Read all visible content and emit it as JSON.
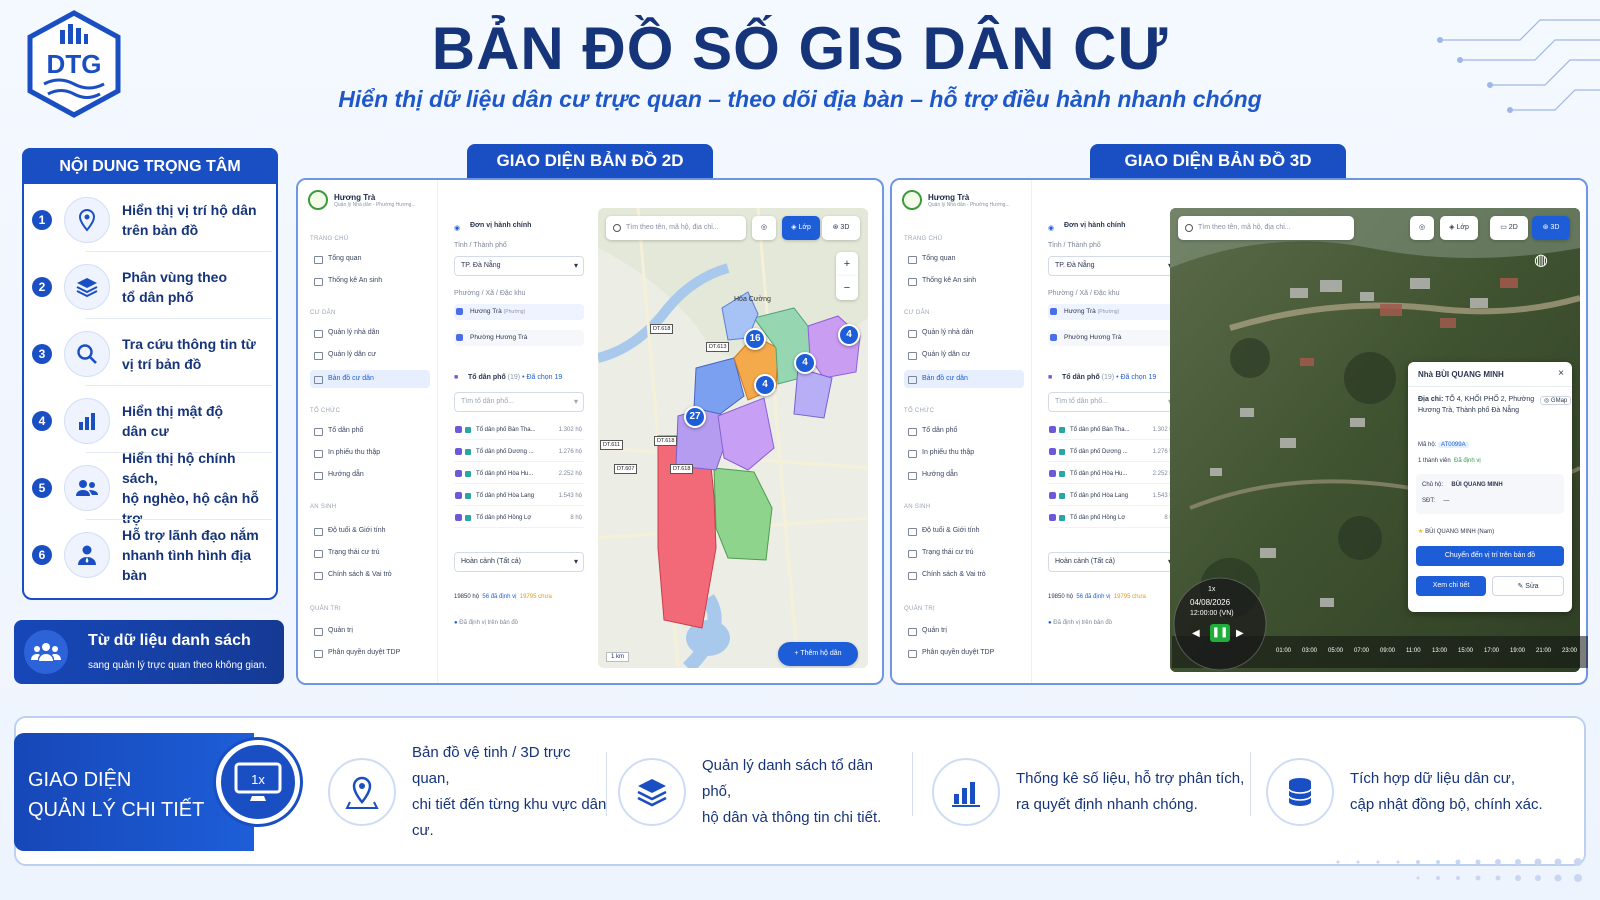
{
  "header": {
    "logo_text": "DTG",
    "title": "BẢN ĐỒ SỐ GIS DÂN CƯ",
    "subtitle": "Hiển thị dữ liệu dân cư trực quan – theo dõi địa bàn – hỗ trợ điều hành nhanh chóng"
  },
  "left_panel": {
    "title": "NỘI DUNG TRỌNG TÂM",
    "items": [
      {
        "num": "1",
        "line1": "Hiển thị vị trí hộ dân",
        "line2": "trên bản đồ",
        "icon": "map-pin-icon"
      },
      {
        "num": "2",
        "line1": "Phân vùng theo",
        "line2": "tổ dân phố",
        "icon": "layers-icon"
      },
      {
        "num": "3",
        "line1": "Tra cứu thông tin từ",
        "line2": "vị trí bản đồ",
        "icon": "search-icon"
      },
      {
        "num": "4",
        "line1": "Hiển thị mật độ",
        "line2": "dân cư",
        "icon": "bar-chart-icon"
      },
      {
        "num": "5",
        "line1": "Hiển thị hộ chính sách,",
        "line2": "hộ nghèo, hộ cận hỗ trợ",
        "icon": "users-icon"
      },
      {
        "num": "6",
        "line1": "Hỗ trợ lãnh đạo nắm",
        "line2": "nhanh tình hình địa bàn",
        "icon": "leader-icon"
      }
    ],
    "callout_title": "Từ dữ liệu danh sách",
    "callout_sub": "sang quản lý trực quan theo không gian."
  },
  "section_2d": {
    "title": "GIAO DIỆN BẢN ĐỒ 2D"
  },
  "section_3d": {
    "title": "GIAO DIỆN BẢN ĐỒ 3D"
  },
  "app": {
    "brand": "Hương Trà",
    "brand_sub": "Quản lý Nhà dân - Phường Hương...",
    "groups": {
      "g1": "TRANG CHỦ",
      "g2": "CƯ DÂN",
      "g3": "TỔ CHỨC",
      "g4": "AN SINH",
      "g5": "QUẢN TRỊ"
    },
    "menu": {
      "tong_quan": "Tổng quan",
      "thong_ke": "Thống kê An sinh",
      "ql_nha_dan": "Quản lý nhà dân",
      "ql_dan_cu": "Quản lý dân cư",
      "ban_do": "Bản đồ cư dân",
      "to_dan_pho": "Tổ dân phố",
      "in_phieu": "In phiếu thu thập",
      "huong_dan": "Hướng dẫn",
      "do_tuoi": "Độ tuổi & Giới tính",
      "trang_thai": "Trạng thái cư trú",
      "chinh_sach": "Chính sách & Vai trò",
      "quan_tri": "Quản trị",
      "phan_quyen": "Phân quyền duyệt TDP"
    },
    "filter": {
      "title": "Đơn vị hành chính",
      "tinh_label": "Tỉnh / Thành phố",
      "tinh_value": "TP. Đà Nẵng",
      "phuong_label": "Phường / Xã / Đặc khu",
      "phuong_1": "Hương Trà",
      "phuong_1_tag": "(Phường)",
      "phuong_2": "Phường Hương Trà",
      "tdp_title": "Tổ dân phố",
      "tdp_count": "(19)",
      "tdp_selected": "• Đã chọn 19",
      "tdp_search": "Tìm tổ dân phố...",
      "tdp_rows": [
        {
          "name": "Tổ dân phố Bàn Tha...",
          "count": "1.302 hộ"
        },
        {
          "name": "Tổ dân phố Dương ...",
          "count": "1.276 hộ"
        },
        {
          "name": "Tổ dân phố Hòa Hu...",
          "count": "2.252 hộ"
        },
        {
          "name": "Tổ dân phố Hòa Lang",
          "count": "1.543 hộ"
        },
        {
          "name": "Tổ dân phố Hồng Lợ",
          "count": "8 hộ"
        }
      ],
      "hoan_canh": "Hoàn cảnh (Tất cả)",
      "stat_total": "19850 hộ",
      "stat_located": "56 đã định vị",
      "stat_pending": "19795 chưa",
      "legend": "Đã định vị trên bản đồ"
    },
    "map": {
      "search_placeholder": "Tìm theo tên, mã hộ, địa chỉ...",
      "layer_btn": "Lớp",
      "btn_2d": "2D",
      "btn_3d": "3D",
      "zoom_in": "+",
      "zoom_out": "−",
      "place_label": "Hòa Cường",
      "pins": [
        "16",
        "4",
        "4",
        "4",
        "27"
      ],
      "roads": [
        "DT.618",
        "DT.613",
        "DT.611",
        "DT.607",
        "DT.618",
        "DT.618"
      ],
      "scale": "1 km",
      "add_btn": "+ Thêm hộ dân"
    }
  },
  "popup": {
    "title": "Nhà BÙI QUANG MINH",
    "close": "×",
    "address_label": "Địa chỉ:",
    "address": "TỔ 4, KHỐI PHỐ 2, Phường Hương Trà, Thành phố Đà Nẵng",
    "gmap": "GMap",
    "ma_ho_label": "Mã hộ:",
    "ma_ho": "AT0099A",
    "members": "1 thành viên",
    "located": "Đã định vị",
    "chu_ho_label": "Chủ hộ:",
    "chu_ho": "BÙI QUANG MINH",
    "sdt_label": "SĐT:",
    "sdt": "—",
    "member_item": "BÙI QUANG MINH (Nam)",
    "btn_move": "Chuyển đến vị trí trên bản đồ",
    "btn_detail": "Xem chi tiết",
    "btn_edit": "Sửa"
  },
  "timeline": {
    "speed": "1x",
    "date": "04/08/2026",
    "time": "12:00:00 (VN)",
    "ticks": [
      "01:00",
      "03:00",
      "05:00",
      "07:00",
      "09:00",
      "11:00",
      "13:00",
      "15:00",
      "17:00",
      "19:00",
      "21:00",
      "23:00"
    ]
  },
  "bottom": {
    "left_line1": "GIAO DIỆN",
    "left_line2": "QUẢN LÝ CHI TIẾT",
    "badge": "1x",
    "features": [
      {
        "line1": "Bản đồ vệ tinh / 3D trực quan,",
        "line2": "chi tiết đến từng khu vực dân cư.",
        "icon": "map-location-icon"
      },
      {
        "line1": "Quản lý danh sách tổ dân phố,",
        "line2": "hộ dân và thông tin chi tiết.",
        "icon": "layers-icon"
      },
      {
        "line1": "Thống kê số liệu, hỗ trợ phân tích,",
        "line2": "ra quyết định nhanh chóng.",
        "icon": "bar-chart-icon"
      },
      {
        "line1": "Tích hợp dữ liệu dân cư,",
        "line2": "cập nhật đồng bộ, chính xác.",
        "icon": "database-icon"
      }
    ]
  },
  "colors": {
    "brand": "#1a4fc4",
    "title": "#16347a",
    "accent": "#1d5ed8"
  }
}
